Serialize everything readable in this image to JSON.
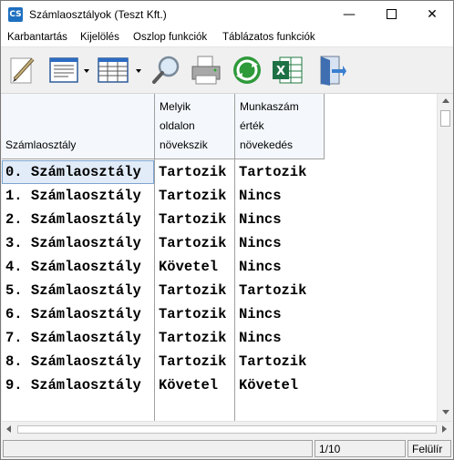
{
  "window": {
    "title": "Számlaosztályok (Teszt Kft.)",
    "app_icon_text": "CS",
    "minimize_glyph": "—",
    "close_glyph": "✕"
  },
  "menu": {
    "items": [
      "Karbantartás",
      "Kijelölés",
      "Oszlop funkciók",
      "Táblázatos funkciók"
    ]
  },
  "toolbar": {
    "icons": [
      "pencil-edit-icon",
      "form-view-icon",
      "table-view-icon",
      "search-magnifier-icon",
      "printer-icon",
      "refresh-icon",
      "excel-export-icon",
      "exit-door-icon"
    ]
  },
  "table": {
    "headers": [
      {
        "lines": [
          "Számlaosztály"
        ]
      },
      {
        "lines": [
          "Melyik",
          "oldalon",
          "növekszik"
        ]
      },
      {
        "lines": [
          "Munkaszám",
          "érték",
          "növekedés"
        ]
      }
    ],
    "rows": [
      [
        "0. Számlaosztály",
        "Tartozik",
        "Tartozik"
      ],
      [
        "1. Számlaosztály",
        "Tartozik",
        "Nincs"
      ],
      [
        "2. Számlaosztály",
        "Tartozik",
        "Nincs"
      ],
      [
        "3. Számlaosztály",
        "Tartozik",
        "Nincs"
      ],
      [
        "4. Számlaosztály",
        "Követel",
        "Nincs"
      ],
      [
        "5. Számlaosztály",
        "Tartozik",
        "Tartozik"
      ],
      [
        "6. Számlaosztály",
        "Tartozik",
        "Nincs"
      ],
      [
        "7. Számlaosztály",
        "Tartozik",
        "Nincs"
      ],
      [
        "8. Számlaosztály",
        "Tartozik",
        "Tartozik"
      ],
      [
        "9. Számlaosztály",
        "Követel",
        "Követel"
      ]
    ],
    "selected_row": 0
  },
  "status": {
    "left": "",
    "record": "1/10",
    "mode": "Felülír"
  },
  "colors": {
    "header_bg": "#f4f8fd",
    "selection_bg": "#e2ecf8",
    "selection_border": "#7fa4d0"
  }
}
